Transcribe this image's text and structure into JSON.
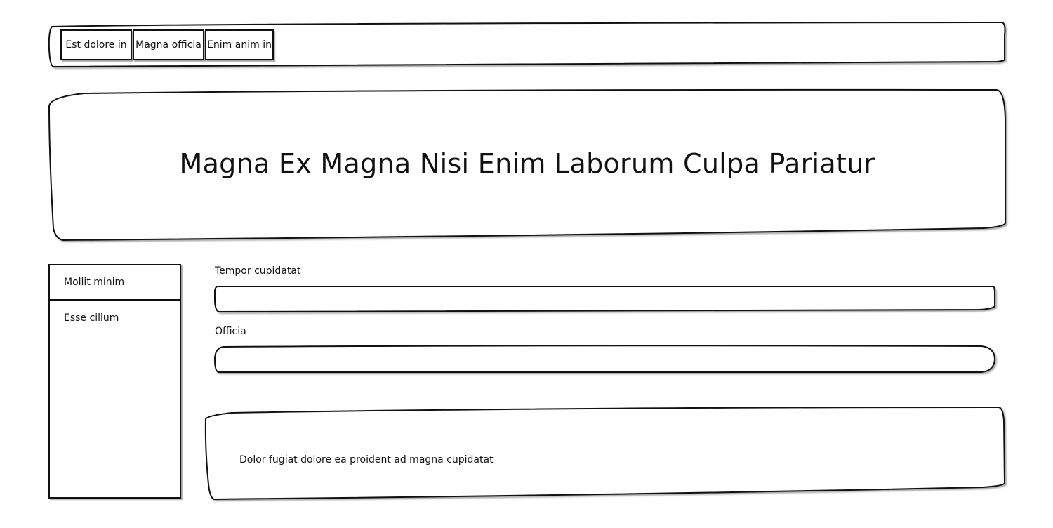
{
  "nav": {
    "tabs": [
      {
        "label": "Est dolore in"
      },
      {
        "label": "Magna officia"
      },
      {
        "label": "Enim anim in"
      }
    ]
  },
  "hero": {
    "title": "Magna Ex Magna Nisi Enim Laborum Culpa Pariatur"
  },
  "sidebar": {
    "items": [
      {
        "label": "Mollit minim"
      },
      {
        "label": "Esse cillum"
      }
    ]
  },
  "form": {
    "fields": [
      {
        "label": "Tempor cupidatat",
        "value": ""
      },
      {
        "label": "Officia",
        "value": ""
      }
    ]
  },
  "message": {
    "text": "Dolor fugiat dolore ea proident ad magna cupidatat"
  }
}
